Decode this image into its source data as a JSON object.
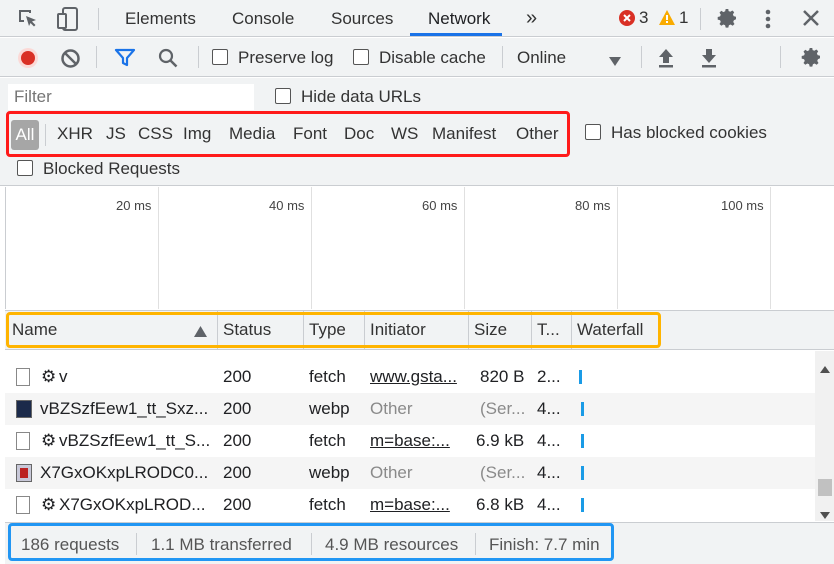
{
  "tabs": {
    "elements": "Elements",
    "console": "Console",
    "sources": "Sources",
    "network": "Network",
    "more": "»",
    "errors": "3",
    "warnings": "1"
  },
  "toolbar": {
    "preserve_log": "Preserve log",
    "disable_cache": "Disable cache",
    "throttle": "Online"
  },
  "filter": {
    "placeholder": "Filter",
    "hide_data_urls": "Hide data URLs",
    "types": [
      "All",
      "XHR",
      "JS",
      "CSS",
      "Img",
      "Media",
      "Font",
      "Doc",
      "WS",
      "Manifest",
      "Other"
    ],
    "has_blocked_cookies": "Has blocked cookies",
    "blocked_requests": "Blocked Requests"
  },
  "overview": {
    "ticks": [
      "20 ms",
      "40 ms",
      "60 ms",
      "80 ms",
      "100 ms"
    ]
  },
  "table": {
    "headers": {
      "name": "Name",
      "status": "Status",
      "type": "Type",
      "initiator": "Initiator",
      "size": "Size",
      "time": "T...",
      "waterfall": "Waterfall"
    },
    "rows": [
      {
        "name": "v",
        "status": "200",
        "type": "fetch",
        "initiator": "www.gsta...",
        "size": "820 B",
        "time": "2...",
        "icon": "gear-doc-icon"
      },
      {
        "name": "vBZSzfEew1_tt_Sxz...",
        "status": "200",
        "type": "webp",
        "initiator": "Other",
        "size": "(Ser...",
        "time": "4...",
        "icon": "image-thumbnail-icon"
      },
      {
        "name": "vBZSzfEew1_tt_S...",
        "status": "200",
        "type": "fetch",
        "initiator": "m=base:...",
        "size": "6.9 kB",
        "time": "4...",
        "icon": "gear-doc-icon"
      },
      {
        "name": "X7GxOKxpLRODC0...",
        "status": "200",
        "type": "webp",
        "initiator": "Other",
        "size": "(Ser...",
        "time": "4...",
        "icon": "image-thumbnail-icon"
      },
      {
        "name": "X7GxOKxpLROD...",
        "status": "200",
        "type": "fetch",
        "initiator": "m=base:...",
        "size": "6.8 kB",
        "time": "4...",
        "icon": "gear-doc-icon"
      }
    ]
  },
  "status_bar": {
    "requests": "186 requests",
    "transferred": "1.1 MB transferred",
    "resources": "4.9 MB resources",
    "finish": "Finish: 7.7 min"
  },
  "colors": {
    "accent": "#1a73e8",
    "highlight_red": "#ff1a1a",
    "highlight_orange": "#ffb400",
    "highlight_blue": "#2196f3",
    "record": "#d93025"
  }
}
